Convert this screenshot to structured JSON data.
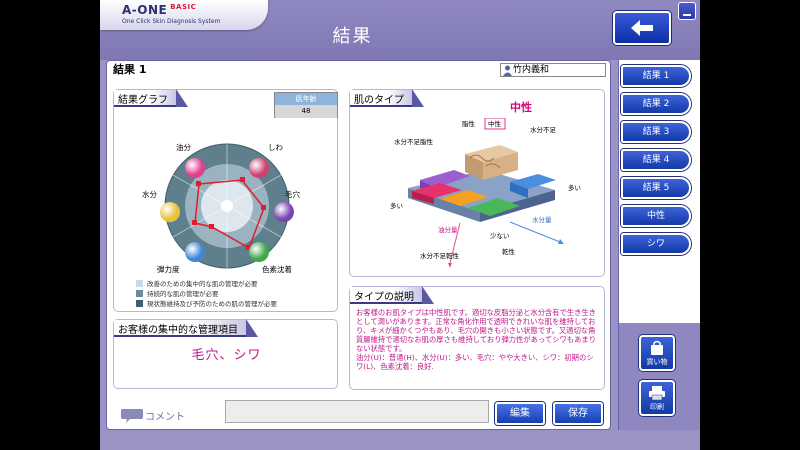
{
  "header": {
    "logo": "A-ONE",
    "logo_edition": "BASIC",
    "logo_sub": "One Click Skin Diagnosis System",
    "title": "結果"
  },
  "main": {
    "result_label": "結果 1",
    "user_name": "竹内義和",
    "graph": {
      "title": "結果グラフ",
      "age_header": "肌年齢",
      "age_value": "48",
      "axes": [
        {
          "label": "油分",
          "color": "#e04090"
        },
        {
          "label": "しわ",
          "color": "#d04070"
        },
        {
          "label": "毛穴",
          "color": "#7a46b0"
        },
        {
          "label": "色素沈着",
          "color": "#3ea84a"
        },
        {
          "label": "弾力度",
          "color": "#3f86d4"
        },
        {
          "label": "水分",
          "color": "#e9c23a"
        }
      ],
      "legend": [
        {
          "text": "改善のための集中的な肌の管理が必要",
          "color": "#cbd8e6"
        },
        {
          "text": "持続的な肌の管理が必要",
          "color": "#6b8aa0"
        },
        {
          "text": "現状態維持及び予防のための肌の管理が必要",
          "color": "#3f5f6e"
        }
      ]
    },
    "focus": {
      "title": "お客様の集中的な管理項目",
      "value": "毛穴、シワ"
    },
    "type": {
      "title": "肌のタイプ",
      "result": "中性",
      "labels": {
        "dry_lack_oily": "水分不足脂性",
        "oily": "脂性",
        "neutral": "中性",
        "dry_lack": "水分不足",
        "many_right": "多い",
        "many_left": "多い",
        "oil_amount": "油分量",
        "water_amount": "水分量",
        "few": "少ない",
        "dry_lack_dry": "水分不足乾性",
        "dry": "乾性"
      }
    },
    "desc": {
      "title": "タイプの説明",
      "text": "お客様のお肌タイプは中性肌です。適切な皮脂分泌と水分含有で生き生きとして潤いがあります。正常な角化作用で透明できれいな肌を維持しており、キメが細かくつやもあり、毛穴の開きも小さい状態です。又適切な角質層維持で適切なお肌の厚さも維持しており弾力性があってシワもあまりない状態です。",
      "detail": "油分(U)：普通(H)、水分(U)：多い、毛穴：やや大きい、シワ：初期のシワ(L)、色素沈着：良好."
    },
    "comment_label": "コメント",
    "comment_value": "",
    "edit_label": "編集",
    "save_label": "保存"
  },
  "side": {
    "tabs": [
      "結果 1",
      "結果 2",
      "結果 3",
      "結果 4",
      "結果 5",
      "中性",
      "シワ"
    ],
    "shop_label": "買い物",
    "print_label": "印刷"
  },
  "colors": {
    "frame": "#9a93c6",
    "accent": "#143aa6",
    "highlight": "#c0188c"
  }
}
